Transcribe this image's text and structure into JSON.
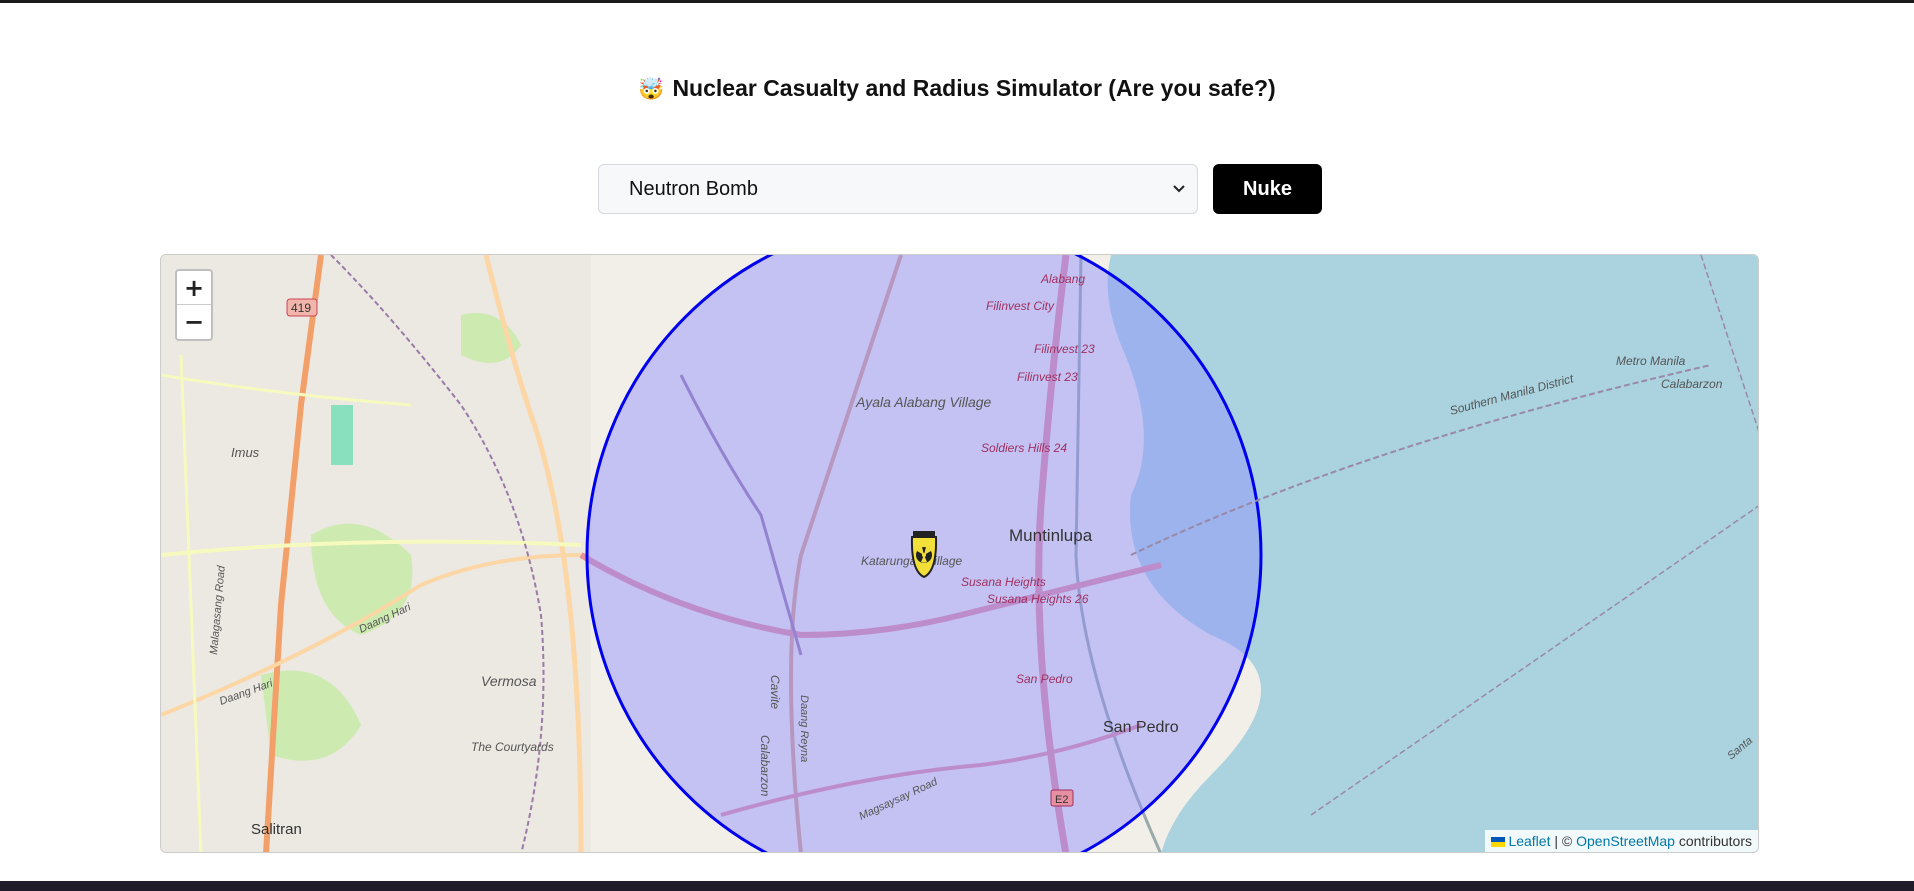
{
  "page": {
    "title_emoji": "🤯",
    "title": "Nuclear Casualty and Radius Simulator (Are you safe?)"
  },
  "controls": {
    "weapon_selected": "Neutron Bomb",
    "nuke_label": "Nuke"
  },
  "map": {
    "zoom_in": "+",
    "zoom_out": "−",
    "blast_center_icon": "nuclear-bomb-icon",
    "blast_fill_color": "#8c8cff",
    "blast_stroke_color": "#0000ee",
    "water_color": "#aad3df",
    "labels": {
      "road_419": "419",
      "imus": "Imus",
      "vermosa": "Vermosa",
      "the_courtyards": "The Courtyards",
      "salitran": "Salitran",
      "daang_hari_1": "Daang Hari",
      "daang_hari_2": "Daang Hari",
      "malagasang_road": "Malagasang Road",
      "alabang": "Alabang",
      "filinvest_city": "Filinvest City",
      "filinvest_23a": "Filinvest 23",
      "filinvest_23b": "Filinvest 23",
      "ayala_alabang": "Ayala Alabang Village",
      "soldiers_hills": "Soldiers Hills 24",
      "muntinlupa": "Muntinlupa",
      "katarungan": "Katarungan Village",
      "susana_heights": "Susana Heights",
      "susana_heights_26": "Susana Heights 26",
      "san_pedro_small": "San Pedro",
      "san_pedro": "San Pedro",
      "e2": "E2",
      "cavite": "Cavite",
      "calabarzon_left": "Calabarzon",
      "daang_reyna": "Daang Reyna",
      "magsaysay_road": "Magsaysay Road",
      "southern_manila": "Southern Manila District",
      "metro_manila": "Metro Manila",
      "calabarzon_right": "Calabarzon",
      "santa": "Santa"
    }
  },
  "attribution": {
    "leaflet": "Leaflet",
    "separator": "| ©",
    "osm": "OpenStreetMap",
    "contributors": "contributors"
  }
}
